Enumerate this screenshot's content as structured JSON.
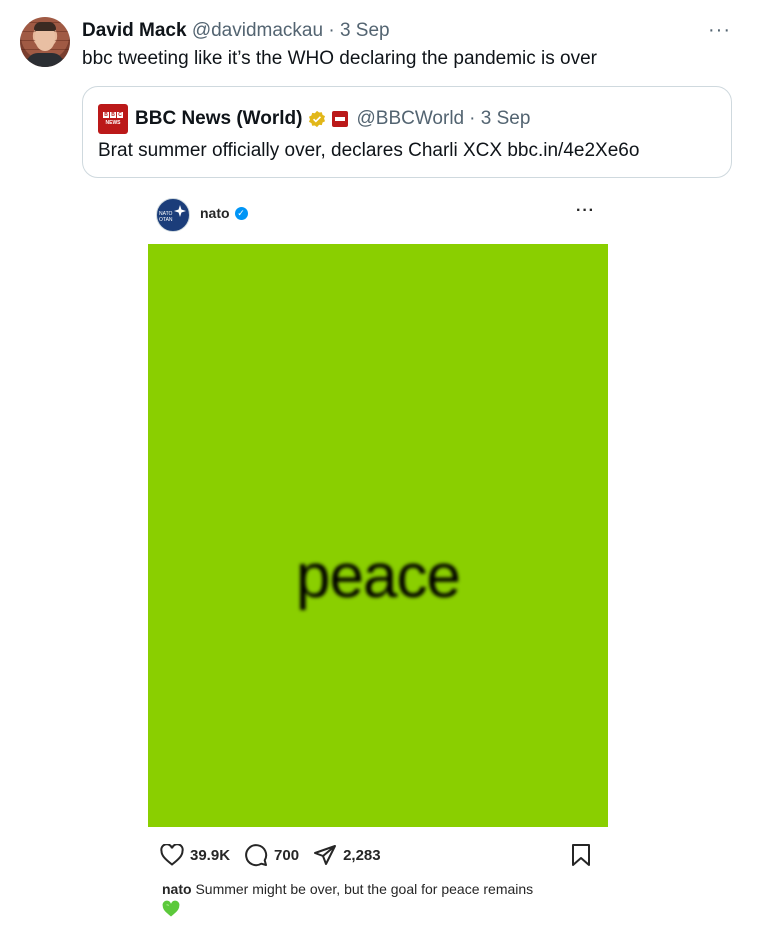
{
  "tweet": {
    "author_name": "David Mack",
    "author_handle": "@davidmackau",
    "date": "· 3 Sep",
    "text": "bbc tweeting like it’s the WHO declaring the pandemic is over",
    "more_label": "···"
  },
  "quoted_tweet": {
    "author_name": "BBC News (World)",
    "author_handle": "@BBCWorld",
    "date": "· 3 Sep",
    "text": "Brat summer officially over, declares Charli XCX bbc.in/4e2Xe6o"
  },
  "instagram_post": {
    "username": "nato",
    "more_label": "···",
    "image_text": "peace",
    "image_color": "#8acf00",
    "likes": "39.9K",
    "comments": "700",
    "shares": "2,283",
    "caption_user": "nato",
    "caption_text": " Summer might be over, but the goal for peace remains",
    "caption_emoji": "green-heart"
  },
  "colors": {
    "muted_text": "#536471",
    "bbc_red": "#bb1919",
    "verified_blue": "#0095f6",
    "gold_badge": "#e2b719"
  }
}
